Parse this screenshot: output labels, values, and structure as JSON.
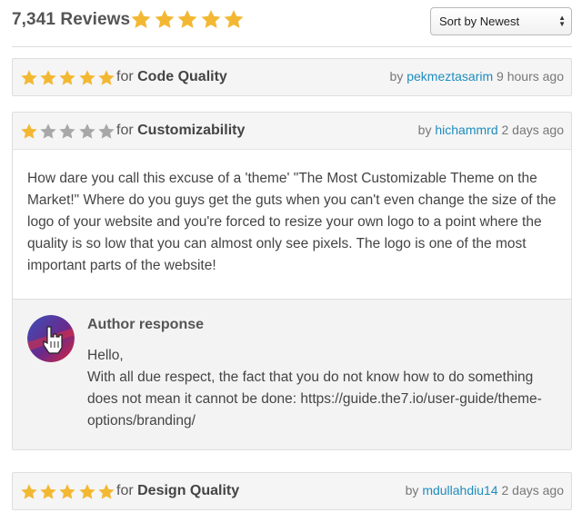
{
  "header": {
    "reviews_count": "7,341 Reviews",
    "overall_rating": 5,
    "sort": {
      "selected": "Sort by Newest"
    }
  },
  "colors": {
    "star_filled": "#f3b833",
    "star_empty": "#a8a8a8",
    "username": "#1e8cbe"
  },
  "reviews": [
    {
      "rating": 5,
      "for_prefix": "for",
      "category": "Code Quality",
      "by_prefix": "by",
      "user": "pekmeztasarim",
      "time": "9 hours ago"
    },
    {
      "rating": 1,
      "for_prefix": "for",
      "category": "Customizability",
      "by_prefix": "by",
      "user": "hichammrd",
      "time": "2 days ago",
      "body": "How dare you call this excuse of a 'theme' \"The Most Customizable Theme on the Market!\" Where do you guys get the guts when you can't even change the size of the logo of your website and you're forced to resize your own logo to a point where the quality is so low that you can almost only see pixels. The logo is one of the most important parts of the website!",
      "author_response": {
        "title": "Author response",
        "greeting": "Hello,",
        "text": "With all due respect, the fact that you do not know how to do something does not mean it cannot be done: https://guide.the7.io/user-guide/theme-options/branding/"
      }
    },
    {
      "rating": 5,
      "for_prefix": "for",
      "category": "Design Quality",
      "by_prefix": "by",
      "user": "mdullahdiu14",
      "time": "2 days ago"
    }
  ]
}
